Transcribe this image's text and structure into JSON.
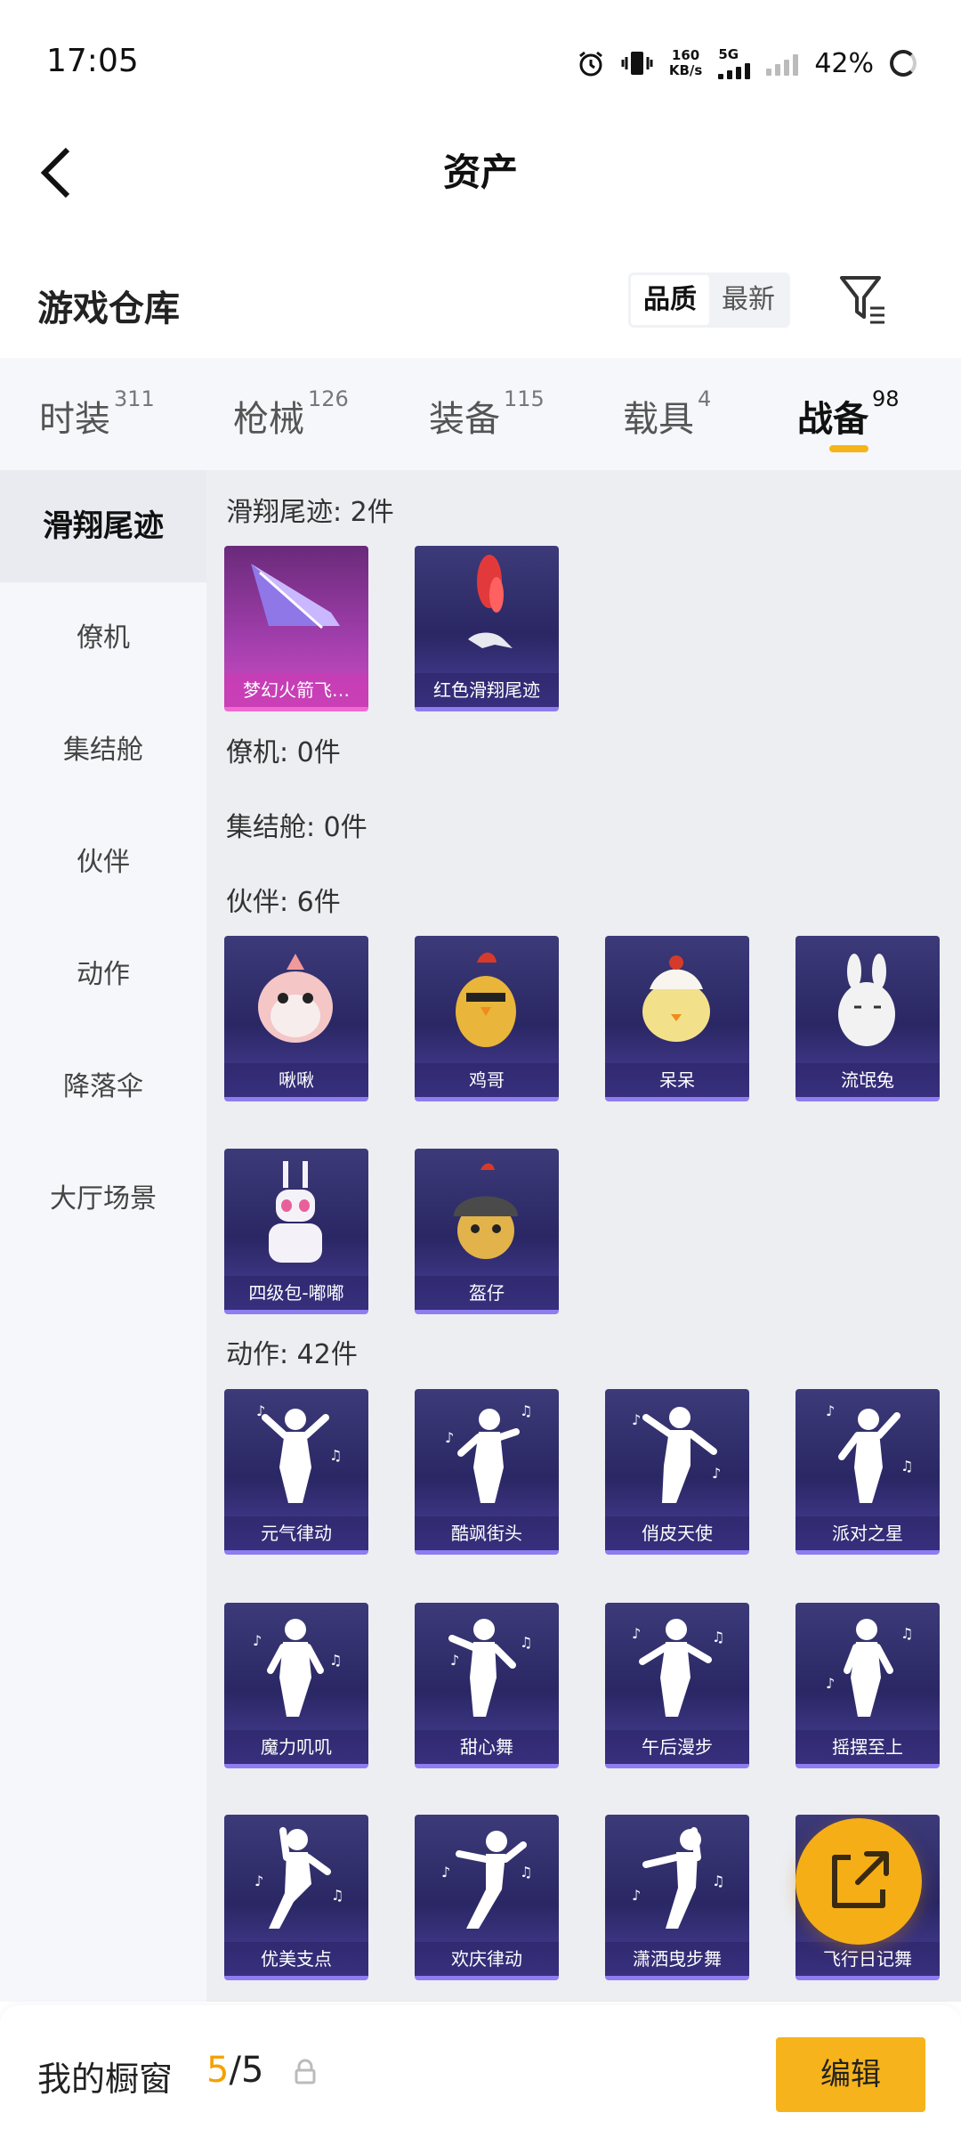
{
  "status_bar": {
    "time": "17:05",
    "net_speed_value": "160",
    "net_speed_unit": "KB/s",
    "network": "5G",
    "battery": "42%"
  },
  "header": {
    "back_icon": "chevron-left-icon",
    "title": "资产"
  },
  "warehouse": {
    "title": "游戏仓库",
    "sort_options": [
      "品质",
      "最新"
    ],
    "sort_selected": "品质",
    "filter_icon": "filter-icon"
  },
  "tabs": [
    {
      "label": "时装",
      "count": "311"
    },
    {
      "label": "枪械",
      "count": "126"
    },
    {
      "label": "装备",
      "count": "115"
    },
    {
      "label": "载具",
      "count": "4"
    },
    {
      "label": "战备",
      "count": "98",
      "active": true
    }
  ],
  "accent_color": "#f5b41a",
  "categories": [
    "滑翔尾迹",
    "僚机",
    "集结舱",
    "伙伴",
    "动作",
    "降落伞",
    "大厅场景"
  ],
  "sections": {
    "glide": {
      "title": "滑翔尾迹: 2件",
      "items": [
        "梦幻火箭飞…",
        "红色滑翔尾迹"
      ]
    },
    "wingman": {
      "title": "僚机: 0件"
    },
    "pod": {
      "title": "集结舱: 0件"
    },
    "partner": {
      "title": "伙伴: 6件",
      "items": [
        "啾啾",
        "鸡哥",
        "呆呆",
        "流氓兔",
        "四级包-嘟嘟",
        "盔仔"
      ]
    },
    "emote": {
      "title": "动作: 42件",
      "items": [
        "元气律动",
        "酷飒街头",
        "俏皮天使",
        "派对之星",
        "魔力叽叽",
        "甜心舞",
        "午后漫步",
        "摇摆至上",
        "优美支点",
        "欢庆律动",
        "潇洒曳步舞",
        "飞行日记舞"
      ]
    }
  },
  "fab_icon": "share-icon",
  "bottom": {
    "showcase_label": "我的橱窗",
    "current": "5",
    "separator": "/",
    "total": "5",
    "lock_icon": "lock-icon",
    "edit_label": "编辑"
  }
}
